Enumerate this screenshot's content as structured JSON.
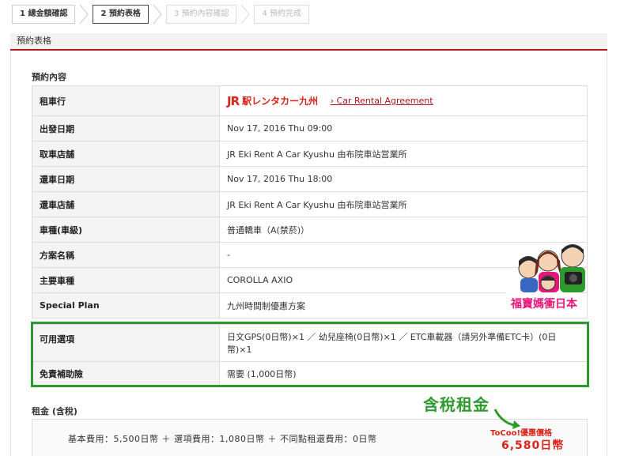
{
  "steps": [
    {
      "label": "1 總金額確認",
      "state": "done"
    },
    {
      "label": "2 預約表格",
      "state": "active"
    },
    {
      "label": "3 預約內容確認",
      "state": "disabled"
    },
    {
      "label": "4 預約完成",
      "state": "disabled"
    }
  ],
  "section_title": "預約表格",
  "reservation": {
    "heading": "預約內容",
    "rows": [
      {
        "key": "租車行",
        "logo_brand": "JR",
        "logo_text": "駅レンタカー九州",
        "link": "› Car Rental Agreement"
      },
      {
        "key": "出發日期",
        "value": "Nov 17, 2016 Thu 09:00"
      },
      {
        "key": "取車店舖",
        "value": "JR Eki Rent A Car Kyushu 由布院車站営業所"
      },
      {
        "key": "還車日期",
        "value": "Nov 17, 2016 Thu 18:00"
      },
      {
        "key": "還車店舖",
        "value": "JR Eki Rent A Car Kyushu 由布院車站営業所"
      },
      {
        "key": "車種(車級)",
        "value": "普通轎車（A(禁菸)）"
      },
      {
        "key": "方案名稱",
        "value": "-"
      },
      {
        "key": "主要車種",
        "value": "COROLLA AXIO"
      },
      {
        "key": "Special Plan",
        "value": "九州時間制優惠方案"
      }
    ]
  },
  "options": {
    "rows": [
      {
        "key": "可用選項",
        "value": "日文GPS(0日幣)×1 ／ 幼兒座椅(0日幣)×1 ／ ETC車載器（請另外準備ETC卡）(0日幣)×1"
      },
      {
        "key": "免責補助險",
        "value": "需要 (1,000日幣)"
      }
    ]
  },
  "price": {
    "heading": "租金 (含稅)",
    "line": "基本費用：5,500日幣 ＋ 選項費用：1,080日幣 ＋ 不同點租還費用：0日幣"
  },
  "annotations": {
    "green_label": "含稅租金",
    "red_label1": "ToCoo!優惠價格",
    "red_label2": "6,580日幣",
    "watermark": "福寶媽衝日本",
    "green_color": "#2e9a2e",
    "red_color": "#d9261c"
  }
}
